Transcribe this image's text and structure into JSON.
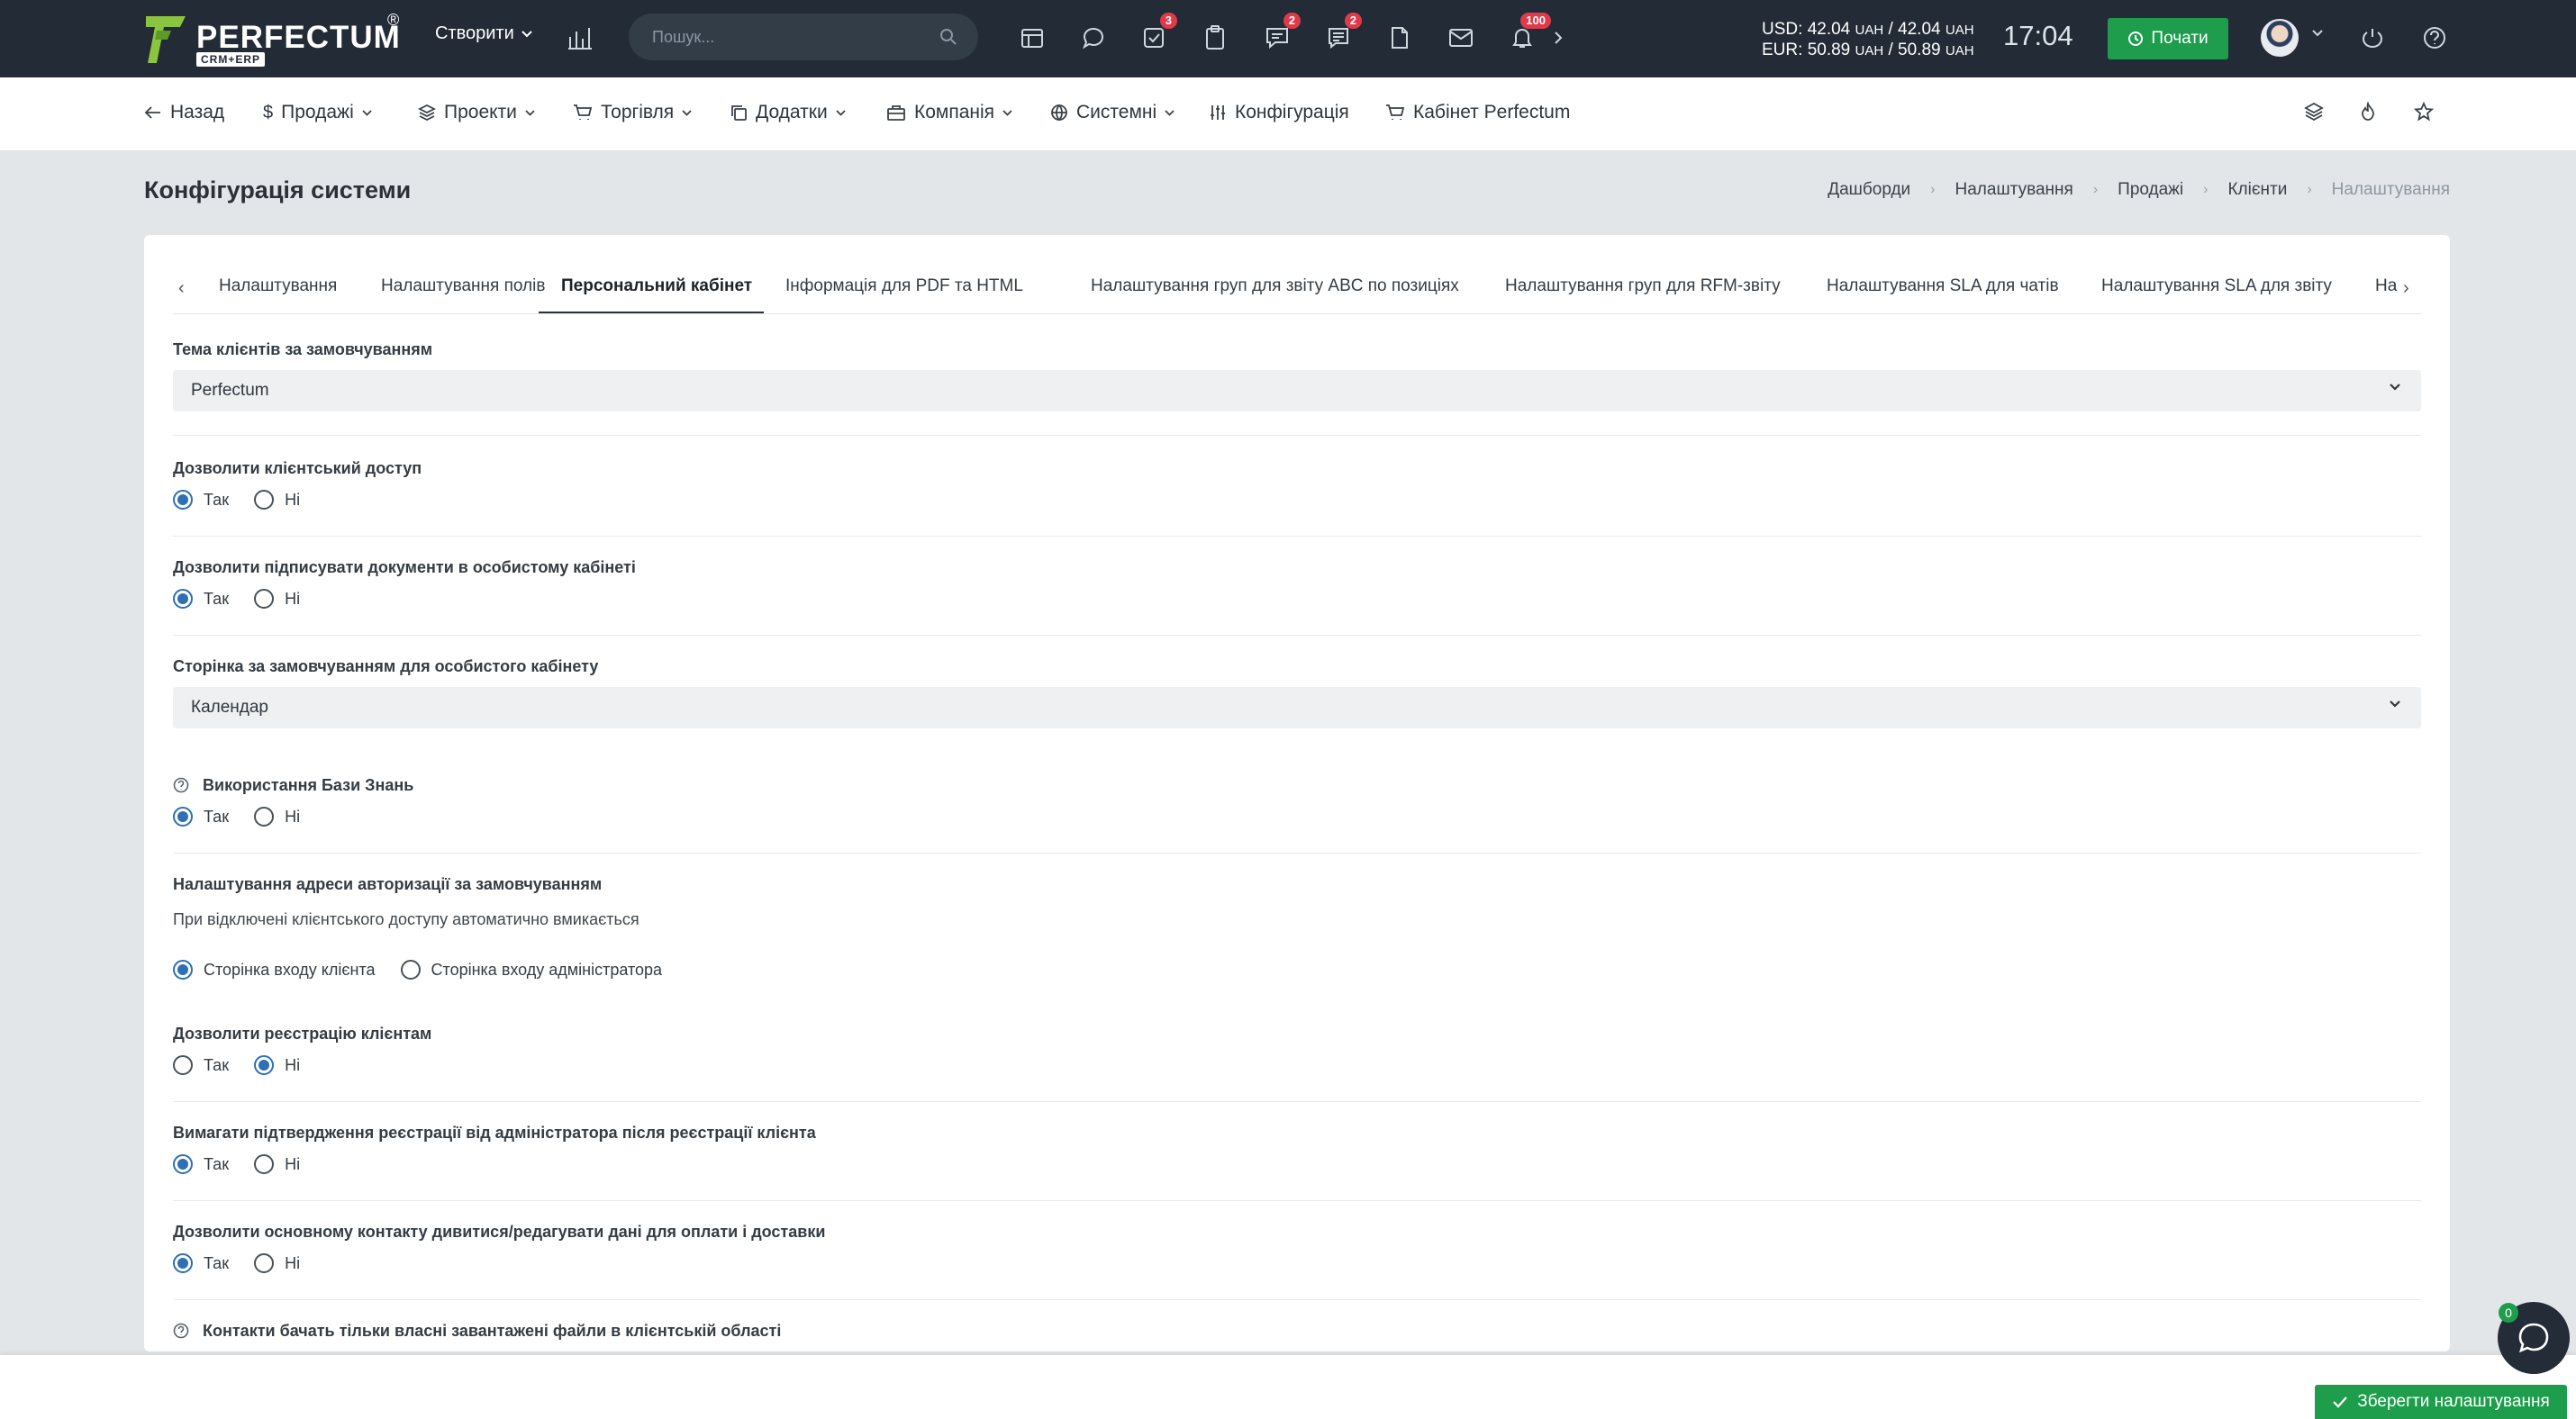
{
  "app": {
    "logo_text": "PERFECTUM",
    "logo_sub": "CRM+ERP",
    "logo_reg": "®",
    "create_label": "Створити",
    "search_placeholder": "Пошук...",
    "badges": {
      "tasks": "3",
      "chat": "2",
      "messages": "2",
      "notifications": "100"
    },
    "rates": {
      "usd_label": "USD:",
      "usd_buy": "42.04",
      "usd_sell": "42.04",
      "eur_label": "EUR:",
      "eur_buy": "50.89",
      "eur_sell": "50.89",
      "currency": "UAH",
      "slash": "/"
    },
    "clock": "17:04",
    "start_label": "Почати"
  },
  "nav": {
    "back": "Назад",
    "sales": "Продажі",
    "projects": "Проекти",
    "trade": "Торгівля",
    "addons": "Додатки",
    "company": "Компанія",
    "system": "Системні",
    "config": "Конфігурація",
    "cabinet": "Кабінет Perfectum"
  },
  "page": {
    "title": "Конфігурація системи",
    "breadcrumb": [
      "Дашборди",
      "Налаштування",
      "Продажі",
      "Клієнти",
      "Налаштування"
    ]
  },
  "tabs": [
    "Налаштування",
    "Налаштування полів",
    "Персональний кабінет",
    "Інформація для PDF та HTML",
    "Налаштування груп для звіту ABC по позиціях",
    "Налаштування груп для RFM-звіту",
    "Налаштування SLA для чатів",
    "Налаштування SLA для звіту",
    "На"
  ],
  "active_tab": "Персональний кабінет",
  "form": {
    "theme": {
      "label": "Тема клієнтів за замовчуванням",
      "value": "Perfectum"
    },
    "client_access": {
      "label": "Дозволити клієнтський доступ",
      "yes": "Так",
      "no": "Ні",
      "selected": "Так"
    },
    "sign_docs": {
      "label": "Дозволити підписувати документи в особистому кабінеті",
      "yes": "Так",
      "no": "Ні",
      "selected": "Так"
    },
    "default_page": {
      "label": "Сторінка за замовчуванням для особистого кабінету",
      "value": "Календар"
    },
    "knowledge_base": {
      "label": "Використання Бази Знань",
      "yes": "Так",
      "no": "Ні",
      "selected": "Так"
    },
    "auth_address": {
      "label": "Налаштування адреси авторизації за замовчуванням",
      "note": "При відключені клієнтського доступу автоматично вмикається",
      "opt_client": "Сторінка входу клієнта",
      "opt_admin": "Сторінка входу адміністратора",
      "selected": "Сторінка входу клієнта"
    },
    "registration": {
      "label": "Дозволити реєстрацію клієнтам",
      "yes": "Так",
      "no": "Ні",
      "selected": "Ні"
    },
    "admin_confirm": {
      "label": "Вимагати підтвердження реєстрації від адміністратора після реєстрації клієнта",
      "yes": "Так",
      "no": "Ні",
      "selected": "Так"
    },
    "payment_data": {
      "label": "Дозволити основному контакту дивитися/редагувати дані для оплати і доставки",
      "yes": "Так",
      "no": "Ні",
      "selected": "Так"
    },
    "own_files": {
      "label": "Контакти бачать тільки власні завантажені файли в клієнтській області"
    }
  },
  "save_label": "Зберегти налаштування",
  "chat_badge": "0",
  "colors": {
    "topbar": "#222b36",
    "accent_green": "#1e9e4d",
    "radio_blue": "#2f6fb3",
    "badge_red": "#e03a4a"
  }
}
